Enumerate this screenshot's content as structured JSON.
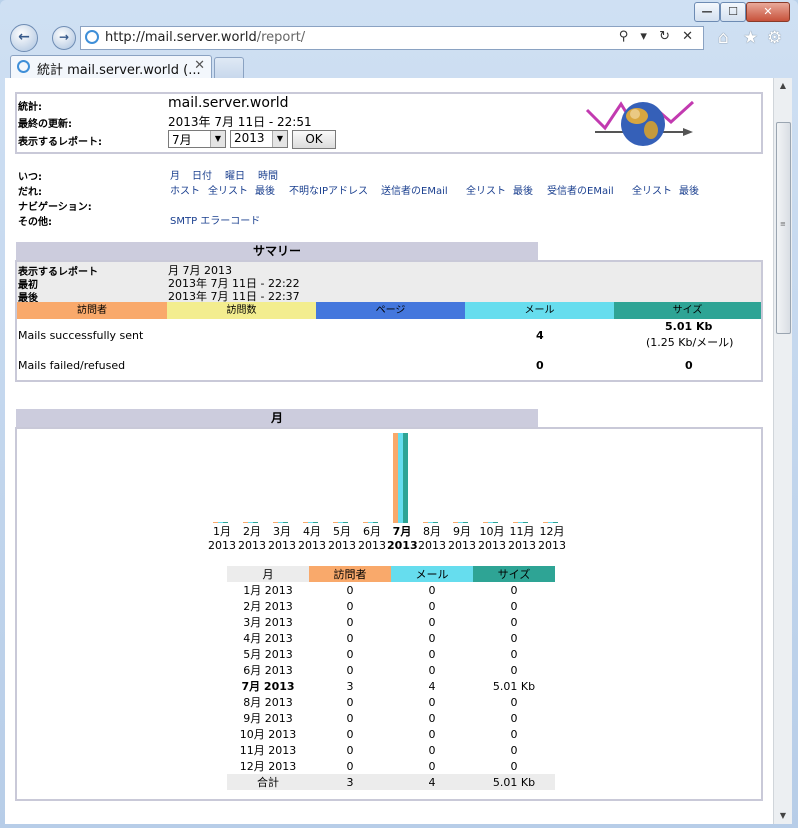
{
  "browser": {
    "url_host": "http://mail.server.world",
    "url_path": "/report/",
    "url_tools": "⚲ ▾ ↻ ✕",
    "tab_title": "統計 mail.server.world (...",
    "tab_close": "✕",
    "back_glyph": "←",
    "fwd_glyph": "→",
    "home_glyph": "⌂",
    "star_glyph": "★",
    "gear_glyph": "⚙",
    "win_min": "—",
    "win_max": "☐",
    "win_close": "✕"
  },
  "header": {
    "stats_label": "統計:",
    "server_name": "mail.server.world",
    "updated_label": "最終の更新:",
    "updated_value": "2013年 7月 11日 - 22:51",
    "report_label": "表示するレポート:",
    "month_select": "7月",
    "year_select": "2013",
    "ok_label": "OK"
  },
  "nav": {
    "when_label": "いつ:",
    "when_links": [
      "月",
      "日付",
      "曜日",
      "時間"
    ],
    "who_label": "だれ:",
    "who_links": [
      "ホスト",
      "全リスト",
      "最後",
      "不明なIPアドレス",
      "送信者のEMail",
      "全リスト",
      "最後",
      "受信者のEMail",
      "全リスト",
      "最後"
    ],
    "navigation_label": "ナビゲーション:",
    "other_label": "その他:",
    "other_links": [
      "SMTP エラーコード"
    ]
  },
  "summary": {
    "title": "サマリー",
    "report_label": "表示するレポート",
    "report_value": "月 7月 2013",
    "first_label": "最初",
    "first_value": "2013年 7月 11日 - 22:22",
    "last_label": "最後",
    "last_value": "2013年 7月 11日 - 22:37",
    "columns": [
      "訪問者",
      "訪問数",
      "ページ",
      "メール",
      "サイズ"
    ],
    "col_colors": [
      "#f9a96b",
      "#f3ed8f",
      "#4477dd",
      "#66ddee",
      "#2ea495"
    ],
    "rows": [
      {
        "label": "Mails successfully sent",
        "mail": "4",
        "size": "5.01 Kb",
        "size_sub": "(1.25 Kb/メール)"
      },
      {
        "label": "Mails failed/refused",
        "mail": "0",
        "size": "0",
        "size_sub": ""
      }
    ]
  },
  "monthly": {
    "title": "月",
    "months": [
      "1月",
      "2月",
      "3月",
      "4月",
      "5月",
      "6月",
      "7月",
      "8月",
      "9月",
      "10月",
      "11月",
      "12月"
    ],
    "year": "2013",
    "table_headers": [
      "月",
      "訪問者",
      "メール",
      "サイズ"
    ],
    "rows": [
      {
        "month": "1月 2013",
        "visitors": "0",
        "mail": "0",
        "size": "0"
      },
      {
        "month": "2月 2013",
        "visitors": "0",
        "mail": "0",
        "size": "0"
      },
      {
        "month": "3月 2013",
        "visitors": "0",
        "mail": "0",
        "size": "0"
      },
      {
        "month": "4月 2013",
        "visitors": "0",
        "mail": "0",
        "size": "0"
      },
      {
        "month": "5月 2013",
        "visitors": "0",
        "mail": "0",
        "size": "0"
      },
      {
        "month": "6月 2013",
        "visitors": "0",
        "mail": "0",
        "size": "0"
      },
      {
        "month": "7月 2013",
        "visitors": "3",
        "mail": "4",
        "size": "5.01 Kb"
      },
      {
        "month": "8月 2013",
        "visitors": "0",
        "mail": "0",
        "size": "0"
      },
      {
        "month": "9月 2013",
        "visitors": "0",
        "mail": "0",
        "size": "0"
      },
      {
        "month": "10月 2013",
        "visitors": "0",
        "mail": "0",
        "size": "0"
      },
      {
        "month": "11月 2013",
        "visitors": "0",
        "mail": "0",
        "size": "0"
      },
      {
        "month": "12月 2013",
        "visitors": "0",
        "mail": "0",
        "size": "0"
      }
    ],
    "total": {
      "label": "合計",
      "visitors": "3",
      "mail": "4",
      "size": "5.01 Kb"
    }
  },
  "chart_data": {
    "type": "bar",
    "categories": [
      "1月 2013",
      "2月 2013",
      "3月 2013",
      "4月 2013",
      "5月 2013",
      "6月 2013",
      "7月 2013",
      "8月 2013",
      "9月 2013",
      "10月 2013",
      "11月 2013",
      "12月 2013"
    ],
    "series": [
      {
        "name": "訪問者",
        "values": [
          0,
          0,
          0,
          0,
          0,
          0,
          3,
          0,
          0,
          0,
          0,
          0
        ],
        "color": "#f9a96b"
      },
      {
        "name": "メール",
        "values": [
          0,
          0,
          0,
          0,
          0,
          0,
          4,
          0,
          0,
          0,
          0,
          0
        ],
        "color": "#66ddee"
      },
      {
        "name": "サイズ",
        "values": [
          0,
          0,
          0,
          0,
          0,
          0,
          5.01,
          0,
          0,
          0,
          0,
          0
        ],
        "color": "#2ea495"
      }
    ],
    "highlight_category": "7月 2013"
  }
}
